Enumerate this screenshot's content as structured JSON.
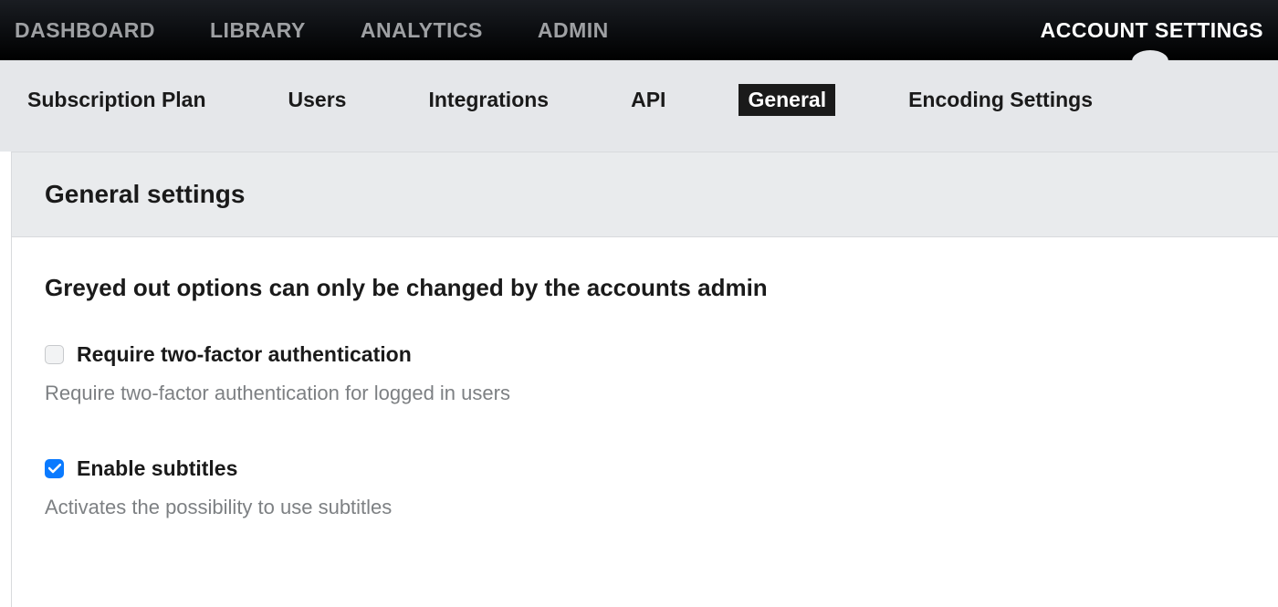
{
  "topNav": {
    "items": [
      {
        "label": "DASHBOARD",
        "active": false
      },
      {
        "label": "LIBRARY",
        "active": false
      },
      {
        "label": "ANALYTICS",
        "active": false
      },
      {
        "label": "ADMIN",
        "active": false
      }
    ],
    "rightItem": {
      "label": "ACCOUNT SETTINGS",
      "active": true
    }
  },
  "subNav": {
    "items": [
      {
        "label": "Subscription Plan",
        "active": false
      },
      {
        "label": "Users",
        "active": false
      },
      {
        "label": "Integrations",
        "active": false
      },
      {
        "label": "API",
        "active": false
      },
      {
        "label": "General",
        "active": true
      },
      {
        "label": "Encoding Settings",
        "active": false
      }
    ]
  },
  "section": {
    "title": "General settings",
    "subtitle": "Greyed out options can only be changed by the accounts admin",
    "settings": [
      {
        "label": "Require two-factor authentication",
        "description": "Require two-factor authentication for logged in users",
        "checked": false
      },
      {
        "label": "Enable subtitles",
        "description": "Activates the possibility to use subtitles",
        "checked": true
      }
    ]
  }
}
